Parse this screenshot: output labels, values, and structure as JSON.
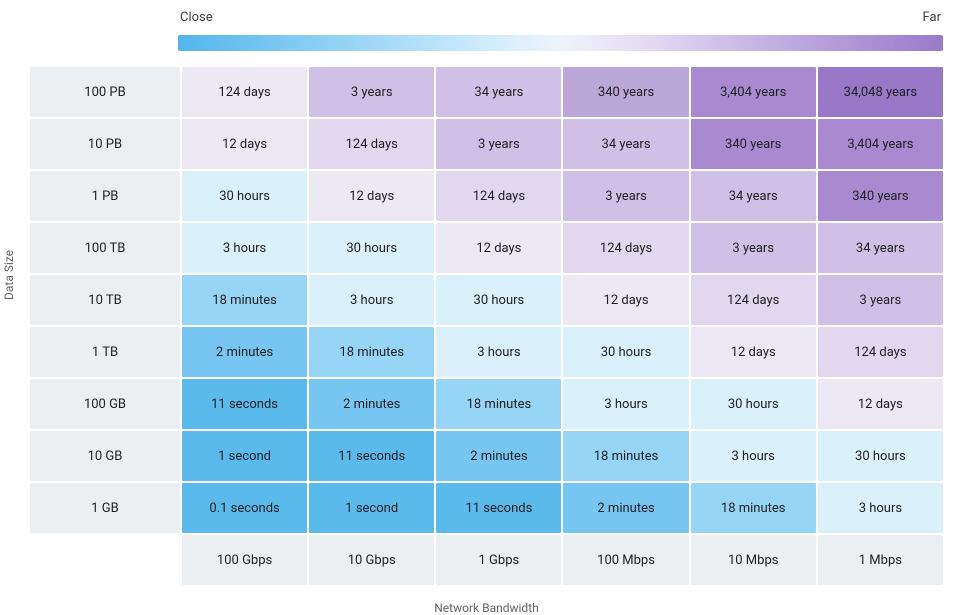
{
  "chart_data": {
    "type": "heatmap",
    "title": "",
    "xlabel": "Network Bandwidth",
    "ylabel": "Data Size",
    "legend": {
      "low_label": "Close",
      "high_label": "Far"
    },
    "x_categories": [
      "100 Gbps",
      "10 Gbps",
      "1 Gbps",
      "100 Mbps",
      "10 Mbps",
      "1 Mbps"
    ],
    "y_categories": [
      "100 PB",
      "10 PB",
      "1 PB",
      "100 TB",
      "10 TB",
      "1 TB",
      "100 GB",
      "10 GB",
      "1 GB"
    ],
    "colors": {
      "b5": "#5abaec",
      "b4": "#77c6f1",
      "b3": "#96d5f5",
      "b2": "#bbe4f8",
      "b1": "#daf0fb",
      "p1": "#ece8f4",
      "p2": "#e1d8ef",
      "p3": "#cfc1e5",
      "p4": "#bca7d9",
      "p5": "#a98ad0",
      "p6": "#9a78c8"
    },
    "cells": [
      [
        {
          "label": "124 days",
          "c": "p1"
        },
        {
          "label": "3 years",
          "c": "p3"
        },
        {
          "label": "34 years",
          "c": "p3"
        },
        {
          "label": "340 years",
          "c": "p4"
        },
        {
          "label": "3,404 years",
          "c": "p5"
        },
        {
          "label": "34,048 years",
          "c": "p6"
        }
      ],
      [
        {
          "label": "12 days",
          "c": "p1"
        },
        {
          "label": "124 days",
          "c": "p2"
        },
        {
          "label": "3 years",
          "c": "p3"
        },
        {
          "label": "34 years",
          "c": "p3"
        },
        {
          "label": "340 years",
          "c": "p5"
        },
        {
          "label": "3,404 years",
          "c": "p5"
        }
      ],
      [
        {
          "label": "30 hours",
          "c": "b1"
        },
        {
          "label": "12 days",
          "c": "p1"
        },
        {
          "label": "124 days",
          "c": "p2"
        },
        {
          "label": "3 years",
          "c": "p3"
        },
        {
          "label": "34 years",
          "c": "p3"
        },
        {
          "label": "340 years",
          "c": "p5"
        }
      ],
      [
        {
          "label": "3 hours",
          "c": "b1"
        },
        {
          "label": "30 hours",
          "c": "b1"
        },
        {
          "label": "12 days",
          "c": "p1"
        },
        {
          "label": "124 days",
          "c": "p2"
        },
        {
          "label": "3 years",
          "c": "p3"
        },
        {
          "label": "34 years",
          "c": "p3"
        }
      ],
      [
        {
          "label": "18 minutes",
          "c": "b3"
        },
        {
          "label": "3 hours",
          "c": "b1"
        },
        {
          "label": "30 hours",
          "c": "b1"
        },
        {
          "label": "12 days",
          "c": "p1"
        },
        {
          "label": "124 days",
          "c": "p2"
        },
        {
          "label": "3 years",
          "c": "p3"
        }
      ],
      [
        {
          "label": "2 minutes",
          "c": "b4"
        },
        {
          "label": "18 minutes",
          "c": "b3"
        },
        {
          "label": "3 hours",
          "c": "b1"
        },
        {
          "label": "30 hours",
          "c": "b1"
        },
        {
          "label": "12 days",
          "c": "p1"
        },
        {
          "label": "124 days",
          "c": "p2"
        }
      ],
      [
        {
          "label": "11 seconds",
          "c": "b5"
        },
        {
          "label": "2 minutes",
          "c": "b4"
        },
        {
          "label": "18 minutes",
          "c": "b3"
        },
        {
          "label": "3 hours",
          "c": "b1"
        },
        {
          "label": "30 hours",
          "c": "b1"
        },
        {
          "label": "12 days",
          "c": "p1"
        }
      ],
      [
        {
          "label": "1 second",
          "c": "b5"
        },
        {
          "label": "11 seconds",
          "c": "b5"
        },
        {
          "label": "2 minutes",
          "c": "b4"
        },
        {
          "label": "18 minutes",
          "c": "b3"
        },
        {
          "label": "3 hours",
          "c": "b1"
        },
        {
          "label": "30 hours",
          "c": "b1"
        }
      ],
      [
        {
          "label": "0.1 seconds",
          "c": "b5"
        },
        {
          "label": "1 second",
          "c": "b5"
        },
        {
          "label": "11 seconds",
          "c": "b5"
        },
        {
          "label": "2 minutes",
          "c": "b4"
        },
        {
          "label": "18 minutes",
          "c": "b3"
        },
        {
          "label": "3 hours",
          "c": "b1"
        }
      ]
    ]
  }
}
